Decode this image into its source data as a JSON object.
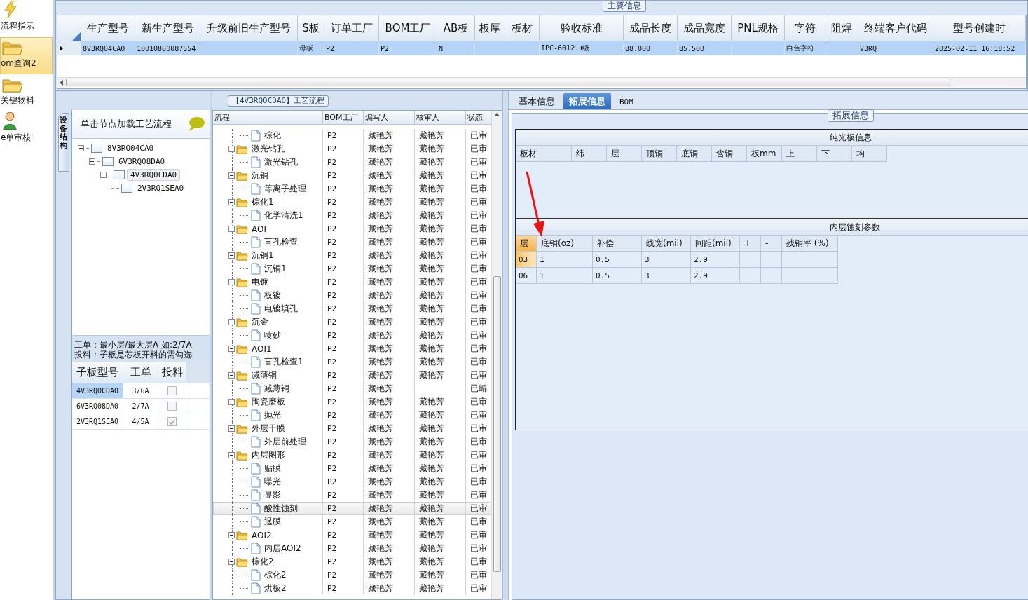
{
  "sidebar": {
    "items": [
      {
        "label": "流程指示",
        "kind": "bolt",
        "selected": false
      },
      {
        "label": "om查询2",
        "kind": "folder",
        "selected": true
      },
      {
        "label": "关键物料",
        "kind": "folder",
        "selected": false
      },
      {
        "label": "e单审核",
        "kind": "user",
        "selected": false
      }
    ]
  },
  "main_info": {
    "title": "主要信息",
    "columns": [
      "生产型号",
      "新生产型号",
      "升级前旧生产型号",
      "S板",
      "订单工厂",
      "BOM工厂",
      "AB板",
      "板厚",
      "板材",
      "验收标准",
      "成品长度",
      "成品宽度",
      "PNL规格",
      "字符",
      "阻焊",
      "终端客户代码",
      "型号创建时"
    ],
    "rows": [
      {
        "selected": true,
        "cells": [
          "8V3RQ04CA0",
          "10010800087554",
          null,
          "母板",
          "P2",
          "P2",
          "N",
          null,
          null,
          "IPC-6012 Ⅱ级",
          "88.000",
          "85.500",
          null,
          "白色字符",
          null,
          "V3RQ",
          "2025-02-11 16:18:52"
        ]
      }
    ]
  },
  "structure_panel": {
    "side_tab": "设备结构",
    "header": "单击节点加载工艺流程",
    "tree": [
      {
        "label": "8V3RQ04CA0",
        "selected": false,
        "children": [
          {
            "label": "6V3RQ08DA0",
            "selected": false,
            "children": [
              {
                "label": "4V3RQ0CDA0",
                "selected": true,
                "children": [
                  {
                    "label": "2V3RQ1SEA0",
                    "selected": false
                  }
                ]
              }
            ]
          }
        ]
      }
    ],
    "notes": [
      "工单：最小层/最大层A 如:2/7A",
      "投料：子板是芯板开料的需勾选"
    ],
    "columns": [
      "子板型号",
      "工单",
      "投料"
    ],
    "rows": [
      {
        "model": "4V3RQ0CDA0",
        "order": "3/6A",
        "checked": false,
        "selected": true
      },
      {
        "model": "6V3RQ08DA0",
        "order": "2/7A",
        "checked": false,
        "selected": false
      },
      {
        "model": "2V3RQ1SEA0",
        "order": "4/5A",
        "checked": true,
        "selected": false
      }
    ]
  },
  "flow_panel": {
    "title": "【4V3RQ0CDA0】工艺流程",
    "columns": [
      "流程",
      "BOM工厂",
      "编写人",
      "核审人",
      "状态"
    ],
    "tree": [
      {
        "children": [
          {
            "kind": "step",
            "name": "棕化",
            "bom": "P2",
            "writer": "藏艳芳",
            "reviewer": "藏艳芳",
            "status": "已审",
            "selected": false
          }
        ]
      },
      {
        "kind": "folder",
        "name": "激光钻孔",
        "bom": "P2",
        "writer": "藏艳芳",
        "reviewer": "藏艳芳",
        "status": "已审",
        "selected": false,
        "children": [
          {
            "kind": "step",
            "name": "激光钻孔",
            "bom": "P2",
            "writer": "藏艳芳",
            "reviewer": "藏艳芳",
            "status": "已审",
            "selected": false
          }
        ]
      },
      {
        "kind": "folder",
        "name": "沉铜",
        "bom": "P2",
        "writer": "藏艳芳",
        "reviewer": "藏艳芳",
        "status": "已审",
        "selected": false,
        "children": [
          {
            "kind": "step",
            "name": "等离子处理",
            "bom": "P2",
            "writer": "藏艳芳",
            "reviewer": "藏艳芳",
            "status": "已审",
            "selected": false
          }
        ]
      },
      {
        "kind": "folder",
        "name": "棕化1",
        "bom": "P2",
        "writer": "藏艳芳",
        "reviewer": "藏艳芳",
        "status": "已审",
        "selected": false,
        "children": [
          {
            "kind": "step",
            "name": "化学清洗1",
            "bom": "P2",
            "writer": "藏艳芳",
            "reviewer": "藏艳芳",
            "status": "已审",
            "selected": false
          }
        ]
      },
      {
        "kind": "folder",
        "name": "AOI",
        "bom": "P2",
        "writer": "藏艳芳",
        "reviewer": "藏艳芳",
        "status": "已审",
        "selected": false,
        "children": [
          {
            "kind": "step",
            "name": "盲孔检查",
            "bom": "P2",
            "writer": "藏艳芳",
            "reviewer": "藏艳芳",
            "status": "已审",
            "selected": false
          }
        ]
      },
      {
        "kind": "folder",
        "name": "沉铜1",
        "bom": "P2",
        "writer": "藏艳芳",
        "reviewer": "藏艳芳",
        "status": "已审",
        "selected": false,
        "children": [
          {
            "kind": "step",
            "name": "沉铜1",
            "bom": "P2",
            "writer": "藏艳芳",
            "reviewer": "藏艳芳",
            "status": "已审",
            "selected": false
          }
        ]
      },
      {
        "kind": "folder",
        "name": "电镀",
        "bom": "P2",
        "writer": "藏艳芳",
        "reviewer": "藏艳芳",
        "status": "已审",
        "selected": false,
        "children": [
          {
            "kind": "step",
            "name": "板镀",
            "bom": "P2",
            "writer": "藏艳芳",
            "reviewer": "藏艳芳",
            "status": "已审",
            "selected": false
          },
          {
            "kind": "step",
            "name": "电镀填孔",
            "bom": "P2",
            "writer": "藏艳芳",
            "reviewer": "藏艳芳",
            "status": "已审",
            "selected": false
          }
        ]
      },
      {
        "kind": "folder",
        "name": "沉金",
        "bom": "P2",
        "writer": "藏艳芳",
        "reviewer": "藏艳芳",
        "status": "已审",
        "selected": false,
        "children": [
          {
            "kind": "step",
            "name": "喷砂",
            "bom": "P2",
            "writer": "藏艳芳",
            "reviewer": "藏艳芳",
            "status": "已审",
            "selected": false
          }
        ]
      },
      {
        "kind": "folder",
        "name": "AOI1",
        "bom": "P2",
        "writer": "藏艳芳",
        "reviewer": "藏艳芳",
        "status": "已审",
        "selected": false,
        "children": [
          {
            "kind": "step",
            "name": "盲孔检查1",
            "bom": "P2",
            "writer": "藏艳芳",
            "reviewer": "藏艳芳",
            "status": "已审",
            "selected": false
          }
        ]
      },
      {
        "kind": "folder",
        "name": "减薄铜",
        "bom": "P2",
        "writer": "藏艳芳",
        "reviewer": "藏艳芳",
        "status": "已审",
        "selected": false,
        "children": [
          {
            "kind": "step",
            "name": "减薄铜",
            "bom": "P2",
            "writer": "藏艳芳",
            "status": "已编",
            "selected": false
          }
        ]
      },
      {
        "kind": "folder",
        "name": "陶瓷磨板",
        "bom": "P2",
        "writer": "藏艳芳",
        "reviewer": "藏艳芳",
        "status": "已审",
        "selected": false,
        "children": [
          {
            "kind": "step",
            "name": "抛光",
            "bom": "P2",
            "writer": "藏艳芳",
            "reviewer": "藏艳芳",
            "status": "已审",
            "selected": false
          }
        ]
      },
      {
        "kind": "folder",
        "name": "外层干膜",
        "bom": "P2",
        "writer": "藏艳芳",
        "reviewer": "藏艳芳",
        "status": "已审",
        "selected": false,
        "children": [
          {
            "kind": "step",
            "name": "外层前处理",
            "bom": "P2",
            "writer": "藏艳芳",
            "reviewer": "藏艳芳",
            "status": "已审",
            "selected": false
          }
        ]
      },
      {
        "kind": "folder",
        "name": "内层图形",
        "bom": "P2",
        "writer": "藏艳芳",
        "reviewer": "藏艳芳",
        "status": "已审",
        "selected": false,
        "children": [
          {
            "kind": "step",
            "name": "贴膜",
            "bom": "P2",
            "writer": "藏艳芳",
            "reviewer": "藏艳芳",
            "status": "已审",
            "selected": false
          },
          {
            "kind": "step",
            "name": "曝光",
            "bom": "P2",
            "writer": "藏艳芳",
            "reviewer": "藏艳芳",
            "status": "已审",
            "selected": false
          },
          {
            "kind": "step",
            "name": "显影",
            "bom": "P2",
            "writer": "藏艳芳",
            "reviewer": "藏艳芳",
            "status": "已审",
            "selected": false
          },
          {
            "kind": "step",
            "name": "酸性蚀刻",
            "bom": "P2",
            "writer": "藏艳芳",
            "reviewer": "藏艳芳",
            "status": "已审",
            "selected": true
          },
          {
            "kind": "step",
            "name": "退膜",
            "bom": "P2",
            "writer": "藏艳芳",
            "reviewer": "藏艳芳",
            "status": "已审",
            "selected": false
          }
        ]
      },
      {
        "kind": "folder",
        "name": "AOI2",
        "bom": "P2",
        "writer": "藏艳芳",
        "reviewer": "藏艳芳",
        "status": "已审",
        "selected": false,
        "children": [
          {
            "kind": "step",
            "name": "内层AOI2",
            "bom": "P2",
            "writer": "藏艳芳",
            "reviewer": "藏艳芳",
            "status": "已审",
            "selected": false
          }
        ]
      },
      {
        "kind": "folder",
        "name": "棕化2",
        "bom": "P2",
        "writer": "藏艳芳",
        "reviewer": "藏艳芳",
        "status": "已审",
        "selected": false,
        "children": [
          {
            "kind": "step",
            "name": "棕化2",
            "bom": "P2",
            "writer": "藏艳芳",
            "reviewer": "藏艳芳",
            "status": "已审",
            "selected": false
          },
          {
            "kind": "step",
            "name": "烘板2",
            "bom": "P2",
            "writer": "藏艳芳",
            "reviewer": "藏艳芳",
            "status": "已审",
            "selected": false
          }
        ]
      }
    ]
  },
  "detail_panel": {
    "tabs": [
      {
        "label": "基本信息",
        "selected": false
      },
      {
        "label": "拓展信息",
        "selected": true
      },
      {
        "label": "BOM",
        "selected": false
      }
    ],
    "group_title": "拓展信息",
    "bare_board": {
      "title": "纯光板信息",
      "columns": [
        "板材",
        "纬",
        "层",
        "顶铜",
        "底铜",
        "含铜",
        "板mm",
        "上",
        "下",
        "均"
      ]
    },
    "inner_etch": {
      "title": "内层蚀刻参数",
      "columns": [
        "层",
        "底铜(oz)",
        "补偿",
        "线宽(mil)",
        "间距(mil)",
        "+",
        "-",
        "残铜率 (%)"
      ],
      "rows": [
        {
          "selected": true,
          "cells": [
            "03",
            "1",
            "0.5",
            "3",
            "2.9",
            null,
            null,
            null
          ]
        },
        {
          "selected": false,
          "cells": [
            "06",
            "1",
            "0.5",
            "3",
            "2.9",
            null,
            null,
            null
          ]
        }
      ]
    }
  }
}
